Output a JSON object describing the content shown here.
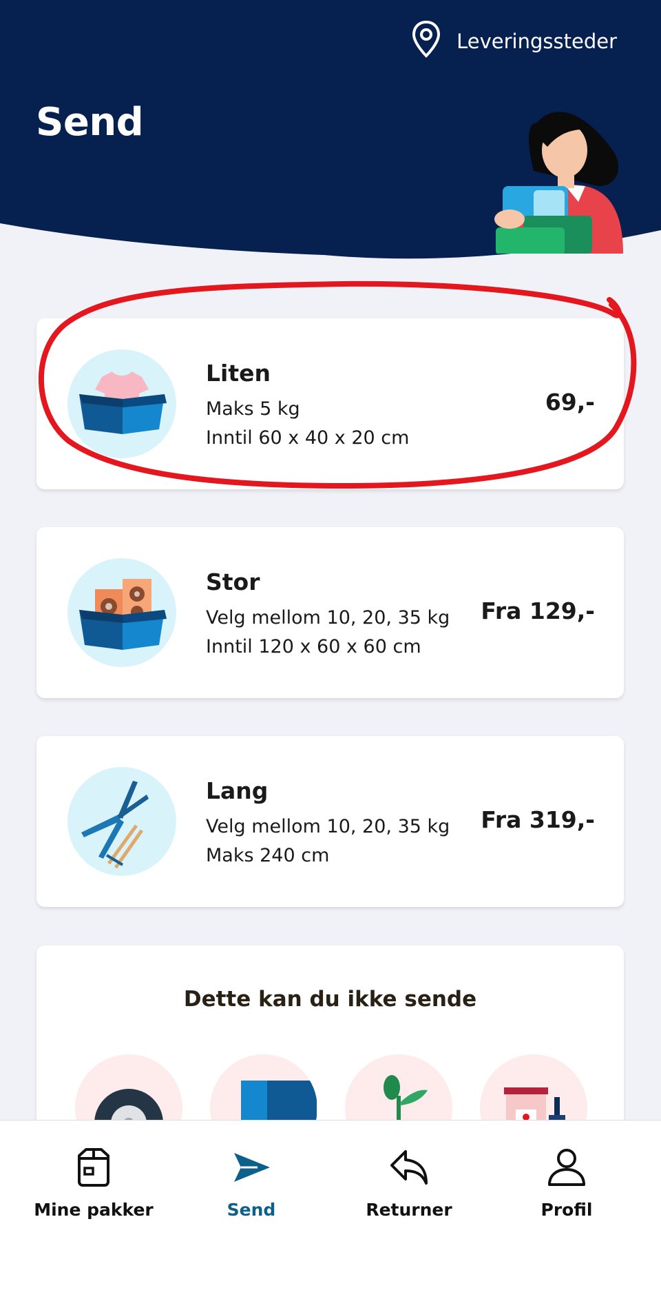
{
  "header": {
    "title": "Send",
    "locations_label": "Leveringssteder",
    "background_color": "#062050"
  },
  "packages": [
    {
      "name": "Liten",
      "line1": "Maks 5 kg",
      "line2": "Inntil 60 x 40 x 20 cm",
      "price": "69,-",
      "icon": "t-shirt-in-box-icon"
    },
    {
      "name": "Stor",
      "line1": "Velg mellom 10, 20, 35 kg",
      "line2": "Inntil 120 x 60 x 60 cm",
      "price": "Fra 129,-",
      "icon": "speakers-in-box-icon"
    },
    {
      "name": "Lang",
      "line1": "Velg mellom 10, 20, 35 kg",
      "line2": "Maks 240 cm",
      "price": "Fra 319,-",
      "icon": "pruning-shears-ski-poles-icon"
    }
  ],
  "restricted": {
    "title": "Dette kan du ikke sende",
    "items": [
      "tire-icon",
      "battery-icon",
      "plant-icon",
      "paint-can-icon"
    ]
  },
  "bottom_nav": [
    {
      "label": "Mine pakker",
      "icon": "package-icon",
      "active": false
    },
    {
      "label": "Send",
      "icon": "send-icon",
      "active": true
    },
    {
      "label": "Returner",
      "icon": "return-icon",
      "active": false
    },
    {
      "label": "Profil",
      "icon": "profile-icon",
      "active": false
    }
  ],
  "colors": {
    "accent": "#0d5f8c",
    "highlight_annotation": "#e4161e"
  }
}
